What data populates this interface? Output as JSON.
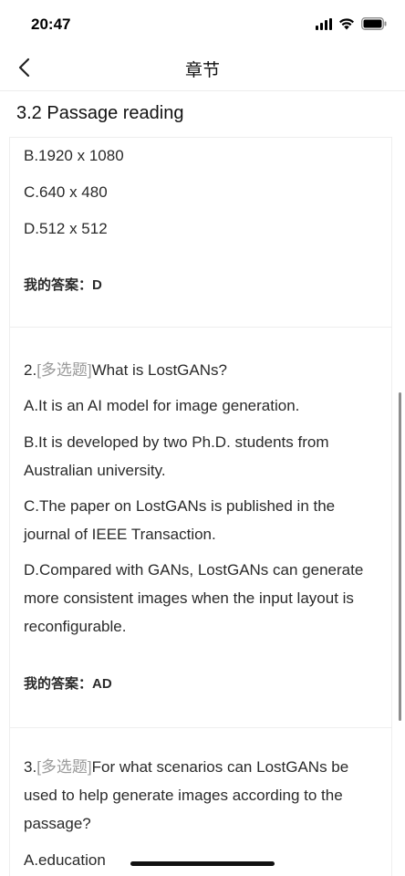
{
  "status_bar": {
    "time": "20:47",
    "icons": [
      "signal-icon",
      "wifi-icon",
      "battery-icon"
    ]
  },
  "nav": {
    "title": "章节",
    "back_icon": "chevron-left-icon"
  },
  "section": {
    "title": "3.2 Passage reading"
  },
  "question1": {
    "options": [
      "B.1920 x 1080",
      "C.640 x 480",
      "D.512 x 512"
    ],
    "answer_label": "我的答案：",
    "answer_value": "D"
  },
  "question2": {
    "number": "2.",
    "tag": "[多选题]",
    "text": "What is LostGANs?",
    "options": [
      "A.It is an AI model for image generation.",
      "B.It is developed by two Ph.D. students from Australian university.",
      "C.The paper on LostGANs is published in the journal of IEEE Transaction.",
      "D.Compared with GANs, LostGANs can generate more consistent images when the input layout is reconfigurable."
    ],
    "answer_label": "我的答案：",
    "answer_value": "AD"
  },
  "question3": {
    "number": "3.",
    "tag": "[多选题]",
    "text": "For what scenarios can LostGANs be used to help generate images according to the passage?",
    "options": [
      "A.education"
    ]
  },
  "colors": {
    "text": "#2a2a2a",
    "tag": "#9a9a9a",
    "divider": "#eeeeee"
  }
}
